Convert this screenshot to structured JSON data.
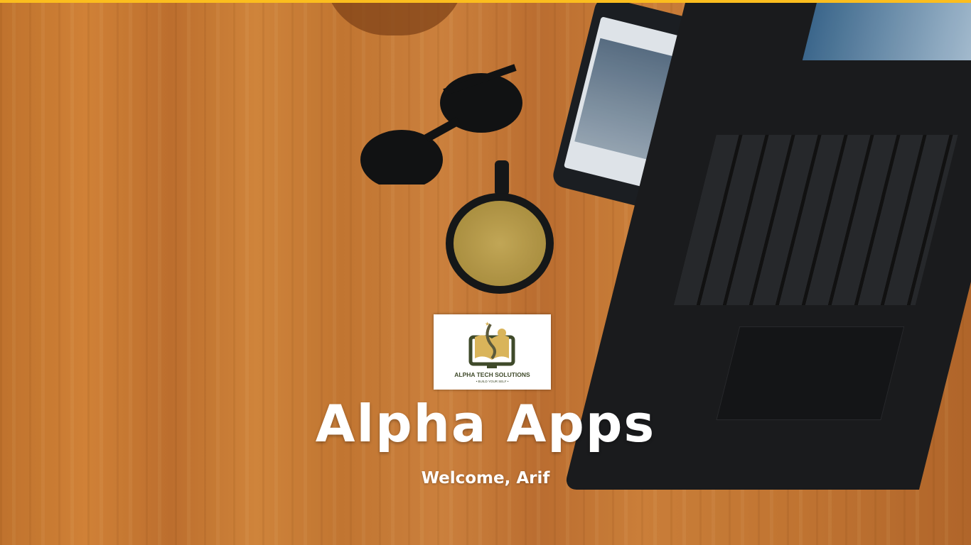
{
  "app": {
    "title": "Alpha Apps",
    "welcome": "Welcome, Arif"
  },
  "logo": {
    "name": "ALPHA TECH SOLUTIONS",
    "tagline": "• BUILD YOUR SELF •"
  },
  "colors": {
    "accent_bar": "#fbbd1e",
    "logo_green": "#3f4a2a",
    "logo_gold": "#d9b45a"
  }
}
